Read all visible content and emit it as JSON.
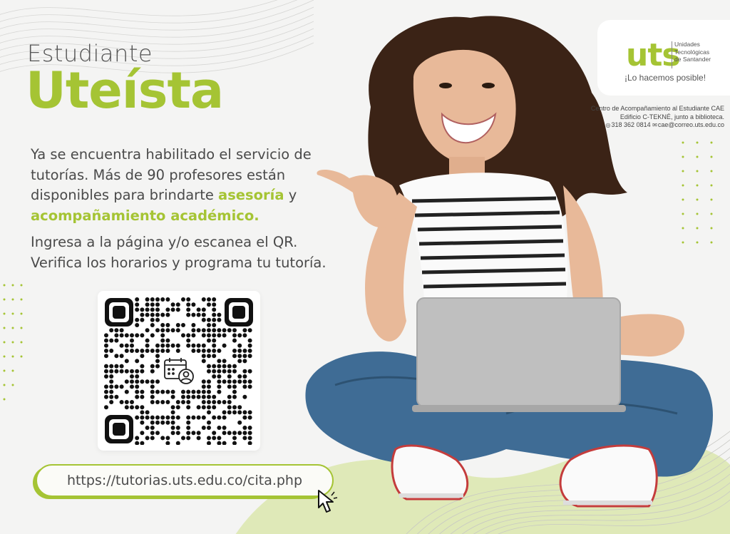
{
  "headline": {
    "line1": "Estudiante",
    "line2": "Uteísta"
  },
  "paragraph1": {
    "text": "Ya se encuentra habilitado el servicio de tutorías. Más de 90 profesores están disponibles para brindarte ",
    "highlight1": "asesoría",
    "connector": " y",
    "highlight2": "acompañamiento académico."
  },
  "paragraph2": {
    "text": "Ingresa a la página y/o escanea el QR. Verifica los horarios y programa tu tutoría."
  },
  "url": "https://tutorias.uts.edu.co/cita.php",
  "logo": {
    "mark": "uts",
    "name_line1": "Unidades",
    "name_line2": "Tecnológicas",
    "name_line3": "de Santander",
    "tagline": "¡Lo hacemos posible!"
  },
  "contact": {
    "line1": "Centro de Acompañamiento al Estudiante CAE",
    "line2": "Edificio C-TEKNÉ, junto a biblioteca.",
    "phone": "318 362 0814",
    "email": "cae@correo.uts.edu.co"
  },
  "colors": {
    "accent": "#a5c434",
    "text": "#4a4a4a",
    "background": "#f4f4f3"
  },
  "icons": [
    "calendar-user-icon",
    "cursor-icon",
    "whatsapp-icon",
    "mail-icon"
  ]
}
